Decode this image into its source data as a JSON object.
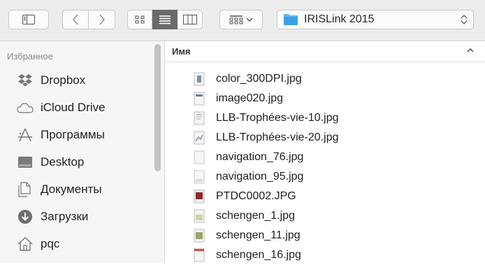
{
  "toolbar": {
    "sidebar_toggle_icon": "sidebar-icon",
    "back_icon": "chevron-left-icon",
    "forward_icon": "chevron-right-icon",
    "view_modes": [
      "icon-view-icon",
      "list-view-icon",
      "column-view-icon"
    ],
    "active_view": "list-view-icon",
    "arrange_icon": "group-icon",
    "path": {
      "label": "IRISLink 2015",
      "icon": "folder-icon"
    }
  },
  "sidebar": {
    "section_title": "Избранное",
    "items": [
      {
        "label": "Dropbox",
        "icon": "dropbox-icon"
      },
      {
        "label": "iCloud Drive",
        "icon": "cloud-icon"
      },
      {
        "label": "Программы",
        "icon": "applications-icon"
      },
      {
        "label": "Desktop",
        "icon": "desktop-icon"
      },
      {
        "label": "Документы",
        "icon": "documents-icon"
      },
      {
        "label": "Загрузки",
        "icon": "downloads-icon"
      },
      {
        "label": "pqc",
        "icon": "home-icon"
      }
    ]
  },
  "list": {
    "column_name": "Имя",
    "sort_icon": "chevron-up-icon",
    "files": [
      {
        "name": "color_300DPI.jpg",
        "icon": "image-file-icon"
      },
      {
        "name": "image020.jpg",
        "icon": "image-file-icon"
      },
      {
        "name": "LLB-Trophées-vie-10.jpg",
        "icon": "image-file-icon"
      },
      {
        "name": "LLB-Trophées-vie-20.jpg",
        "icon": "image-file-icon"
      },
      {
        "name": "navigation_76.jpg",
        "icon": "image-file-icon"
      },
      {
        "name": "navigation_95.jpg",
        "icon": "image-file-icon"
      },
      {
        "name": "PTDC0002.JPG",
        "icon": "image-file-icon"
      },
      {
        "name": "schengen_1.jpg",
        "icon": "image-file-icon"
      },
      {
        "name": "schengen_11.jpg",
        "icon": "image-file-icon"
      },
      {
        "name": "schengen_16.jpg",
        "icon": "image-file-icon"
      }
    ]
  }
}
